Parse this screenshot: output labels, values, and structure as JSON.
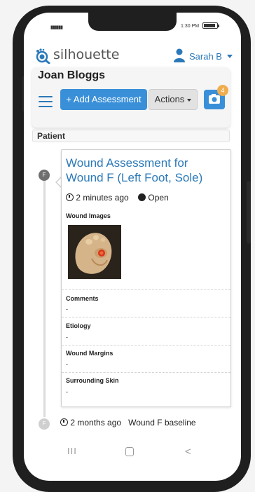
{
  "status_bar": {
    "signal": "▮▮▮▮▮▮",
    "time": "1:30 PM",
    "battery_level": 0.9
  },
  "header": {
    "logo_text": "silhouette",
    "user_name": "Sarah B",
    "logo_icon": "magnifier-foot-icon",
    "user_icon": "person-icon"
  },
  "patient": {
    "name": "Joan Bloggs",
    "tab_label": "Patient"
  },
  "toolbar": {
    "add_label": "+ Add Assessment",
    "actions_label": "Actions",
    "camera_badge": "4",
    "menu_icon": "hamburger-icon",
    "camera_icon": "camera-icon"
  },
  "timeline": {
    "entry": {
      "marker": "F",
      "title": "Wound Assessment for Wound F (Left Foot, Sole)",
      "time_ago": "2 minutes ago",
      "status": "Open",
      "images_label": "Wound Images",
      "sections": [
        {
          "label": "Comments",
          "value": "-"
        },
        {
          "label": "Etiology",
          "value": "-"
        },
        {
          "label": "Wound Margins",
          "value": "-"
        },
        {
          "label": "Surrounding Skin",
          "value": "-"
        }
      ]
    },
    "next_entry": {
      "marker": "F",
      "time_ago": "2 months ago",
      "text": "Wound F baseline"
    }
  },
  "nav": {
    "recent": "III",
    "back": "<"
  },
  "colors": {
    "primary": "#3a90d8",
    "link": "#2b79b8",
    "badge": "#f0ad4e",
    "marker": "#6f6f6f"
  }
}
